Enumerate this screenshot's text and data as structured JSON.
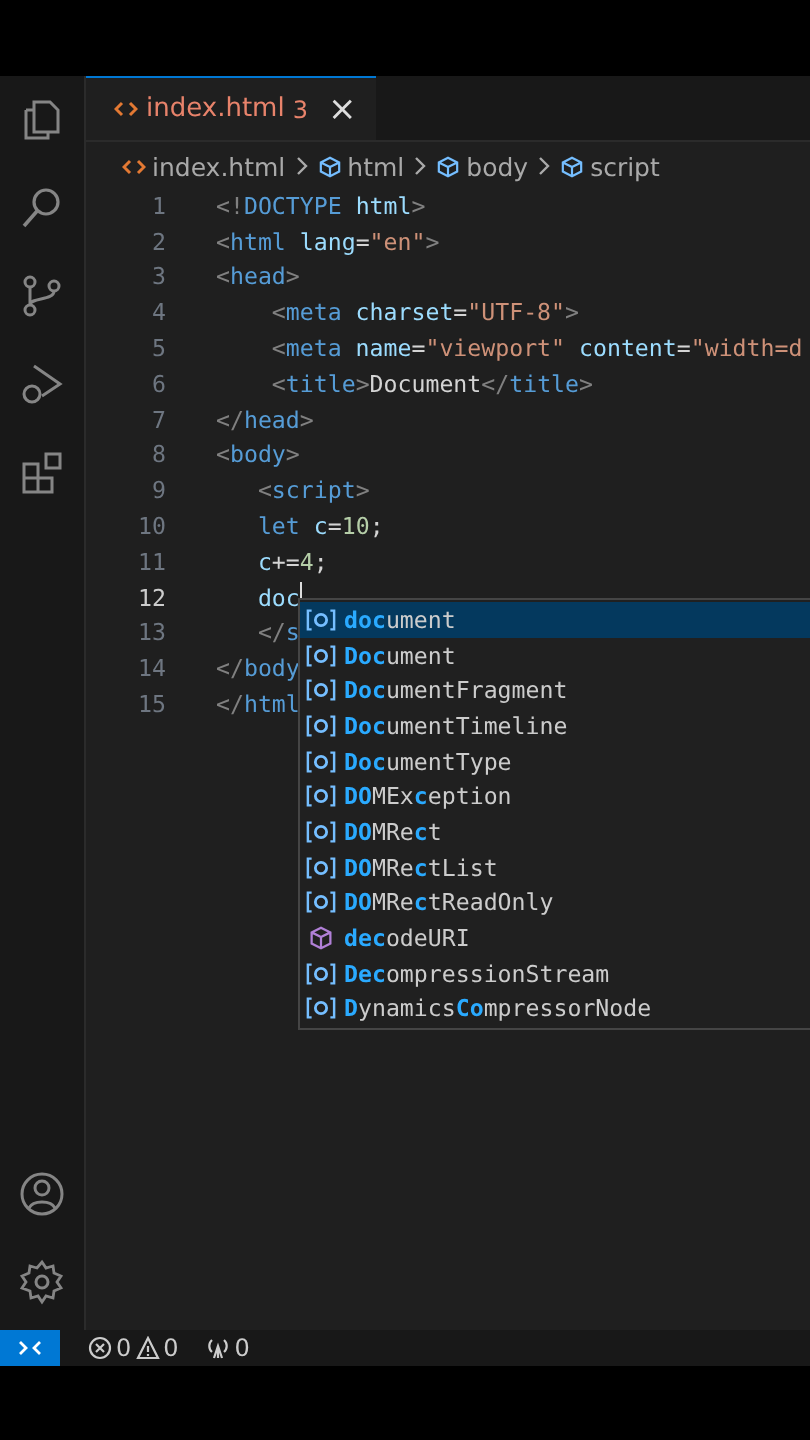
{
  "tab": {
    "label": "index.html",
    "badge": "3",
    "close": "×",
    "selected": true
  },
  "breadcrumb": [
    {
      "label": "index.html",
      "kind": "file"
    },
    {
      "label": "html",
      "kind": "symbol"
    },
    {
      "label": "body",
      "kind": "symbol"
    },
    {
      "label": "script",
      "kind": "symbol"
    }
  ],
  "lines": [
    {
      "number": "1",
      "current": false,
      "tokens": [
        {
          "text": "<!",
          "kind": "punct"
        },
        {
          "text": "DOCTYPE",
          "kind": "tag"
        },
        {
          "text": " html",
          "kind": "attr"
        },
        {
          "text": ">",
          "kind": "punct"
        }
      ]
    },
    {
      "number": "2",
      "current": false,
      "tokens": [
        {
          "text": "<",
          "kind": "punct"
        },
        {
          "text": "html",
          "kind": "tag"
        },
        {
          "text": " lang",
          "kind": "attr"
        },
        {
          "text": "=",
          "kind": "plain"
        },
        {
          "text": "\"en\"",
          "kind": "string"
        },
        {
          "text": ">",
          "kind": "punct"
        }
      ]
    },
    {
      "number": "3",
      "current": false,
      "tokens": [
        {
          "text": "<",
          "kind": "punct"
        },
        {
          "text": "head",
          "kind": "tag"
        },
        {
          "text": ">",
          "kind": "punct"
        }
      ]
    },
    {
      "number": "4",
      "current": false,
      "tokens": [
        {
          "text": "    <",
          "kind": "punct"
        },
        {
          "text": "meta",
          "kind": "tag"
        },
        {
          "text": " charset",
          "kind": "attr"
        },
        {
          "text": "=",
          "kind": "plain"
        },
        {
          "text": "\"UTF-8\"",
          "kind": "string"
        },
        {
          "text": ">",
          "kind": "punct"
        }
      ]
    },
    {
      "number": "5",
      "current": false,
      "tokens": [
        {
          "text": "    <",
          "kind": "punct"
        },
        {
          "text": "meta",
          "kind": "tag"
        },
        {
          "text": " name",
          "kind": "attr"
        },
        {
          "text": "=",
          "kind": "plain"
        },
        {
          "text": "\"viewport\"",
          "kind": "string"
        },
        {
          "text": " content",
          "kind": "attr"
        },
        {
          "text": "=",
          "kind": "plain"
        },
        {
          "text": "\"width=d",
          "kind": "string"
        }
      ]
    },
    {
      "number": "6",
      "current": false,
      "tokens": [
        {
          "text": "    <",
          "kind": "punct"
        },
        {
          "text": "title",
          "kind": "tag"
        },
        {
          "text": ">",
          "kind": "punct"
        },
        {
          "text": "Document",
          "kind": "plain"
        },
        {
          "text": "</",
          "kind": "punct"
        },
        {
          "text": "title",
          "kind": "tag"
        },
        {
          "text": ">",
          "kind": "punct"
        }
      ]
    },
    {
      "number": "7",
      "current": false,
      "tokens": [
        {
          "text": "</",
          "kind": "punct"
        },
        {
          "text": "head",
          "kind": "tag"
        },
        {
          "text": ">",
          "kind": "punct"
        }
      ]
    },
    {
      "number": "8",
      "current": false,
      "tokens": [
        {
          "text": "<",
          "kind": "punct"
        },
        {
          "text": "body",
          "kind": "tag"
        },
        {
          "text": ">",
          "kind": "punct"
        }
      ]
    },
    {
      "number": "9",
      "current": false,
      "tokens": [
        {
          "text": "   <",
          "kind": "punct"
        },
        {
          "text": "script",
          "kind": "tag"
        },
        {
          "text": ">",
          "kind": "punct"
        }
      ]
    },
    {
      "number": "10",
      "current": false,
      "tokens": [
        {
          "text": "   let",
          "kind": "keyword"
        },
        {
          "text": " c",
          "kind": "attr"
        },
        {
          "text": "=",
          "kind": "plain"
        },
        {
          "text": "10",
          "kind": "number"
        },
        {
          "text": ";",
          "kind": "plain"
        }
      ]
    },
    {
      "number": "11",
      "current": false,
      "tokens": [
        {
          "text": "   c",
          "kind": "attr"
        },
        {
          "text": "+=",
          "kind": "plain"
        },
        {
          "text": "4",
          "kind": "number"
        },
        {
          "text": ";",
          "kind": "plain"
        }
      ]
    },
    {
      "number": "12",
      "current": true,
      "tokens": [
        {
          "text": "   doc",
          "kind": "attr"
        }
      ]
    },
    {
      "number": "13",
      "current": false,
      "tokens": [
        {
          "text": "   </",
          "kind": "punct"
        },
        {
          "text": "s",
          "kind": "tag"
        }
      ]
    },
    {
      "number": "14",
      "current": false,
      "tokens": [
        {
          "text": "</",
          "kind": "punct"
        },
        {
          "text": "body",
          "kind": "tag"
        }
      ]
    },
    {
      "number": "15",
      "current": false,
      "tokens": [
        {
          "text": "</",
          "kind": "punct"
        },
        {
          "text": "html",
          "kind": "tag"
        }
      ]
    }
  ],
  "suggestions": [
    {
      "kind": "variable",
      "selected": true,
      "parts": [
        {
          "text": "doc",
          "match": true
        },
        {
          "text": "ument",
          "match": false
        }
      ]
    },
    {
      "kind": "variable",
      "selected": false,
      "parts": [
        {
          "text": "Doc",
          "match": true
        },
        {
          "text": "ument",
          "match": false
        }
      ]
    },
    {
      "kind": "variable",
      "selected": false,
      "parts": [
        {
          "text": "Doc",
          "match": true
        },
        {
          "text": "umentFragment",
          "match": false
        }
      ]
    },
    {
      "kind": "variable",
      "selected": false,
      "parts": [
        {
          "text": "Doc",
          "match": true
        },
        {
          "text": "umentTimeline",
          "match": false
        }
      ]
    },
    {
      "kind": "variable",
      "selected": false,
      "parts": [
        {
          "text": "Doc",
          "match": true
        },
        {
          "text": "umentType",
          "match": false
        }
      ]
    },
    {
      "kind": "variable",
      "selected": false,
      "parts": [
        {
          "text": "DO",
          "match": true
        },
        {
          "text": "MEx",
          "match": false
        },
        {
          "text": "c",
          "match": true
        },
        {
          "text": "eption",
          "match": false
        }
      ]
    },
    {
      "kind": "variable",
      "selected": false,
      "parts": [
        {
          "text": "DO",
          "match": true
        },
        {
          "text": "MRe",
          "match": false
        },
        {
          "text": "c",
          "match": true
        },
        {
          "text": "t",
          "match": false
        }
      ]
    },
    {
      "kind": "variable",
      "selected": false,
      "parts": [
        {
          "text": "DO",
          "match": true
        },
        {
          "text": "MRe",
          "match": false
        },
        {
          "text": "c",
          "match": true
        },
        {
          "text": "tList",
          "match": false
        }
      ]
    },
    {
      "kind": "variable",
      "selected": false,
      "parts": [
        {
          "text": "DO",
          "match": true
        },
        {
          "text": "MRe",
          "match": false
        },
        {
          "text": "c",
          "match": true
        },
        {
          "text": "tReadOnly",
          "match": false
        }
      ]
    },
    {
      "kind": "function",
      "selected": false,
      "parts": [
        {
          "text": "dec",
          "match": true
        },
        {
          "text": "odeURI",
          "match": false
        }
      ]
    },
    {
      "kind": "variable",
      "selected": false,
      "parts": [
        {
          "text": "Dec",
          "match": true
        },
        {
          "text": "ompressionStream",
          "match": false
        }
      ]
    },
    {
      "kind": "variable",
      "selected": false,
      "parts": [
        {
          "text": "D",
          "match": true
        },
        {
          "text": "ynamics",
          "match": false
        },
        {
          "text": "Co",
          "match": true
        },
        {
          "text": "mpressorNode",
          "match": false
        }
      ]
    }
  ],
  "status_bar": {
    "errors": "0",
    "warnings": "0",
    "ports": "0"
  }
}
